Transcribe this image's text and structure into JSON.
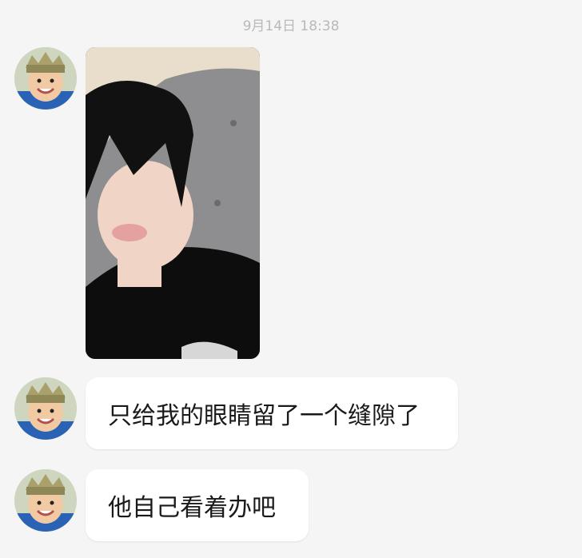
{
  "conversation": {
    "timestamp": "9月14日 18:38",
    "messages": [
      {
        "type": "image",
        "content": "photo"
      },
      {
        "type": "text",
        "content": "只给我的眼睛留了一个缝隙了"
      },
      {
        "type": "text",
        "content": "他自己看着办吧"
      }
    ]
  },
  "colors": {
    "background": "#f5f5f5",
    "bubble": "#ffffff",
    "timestamp": "#b9b9b9",
    "text": "#1a1a1a"
  }
}
